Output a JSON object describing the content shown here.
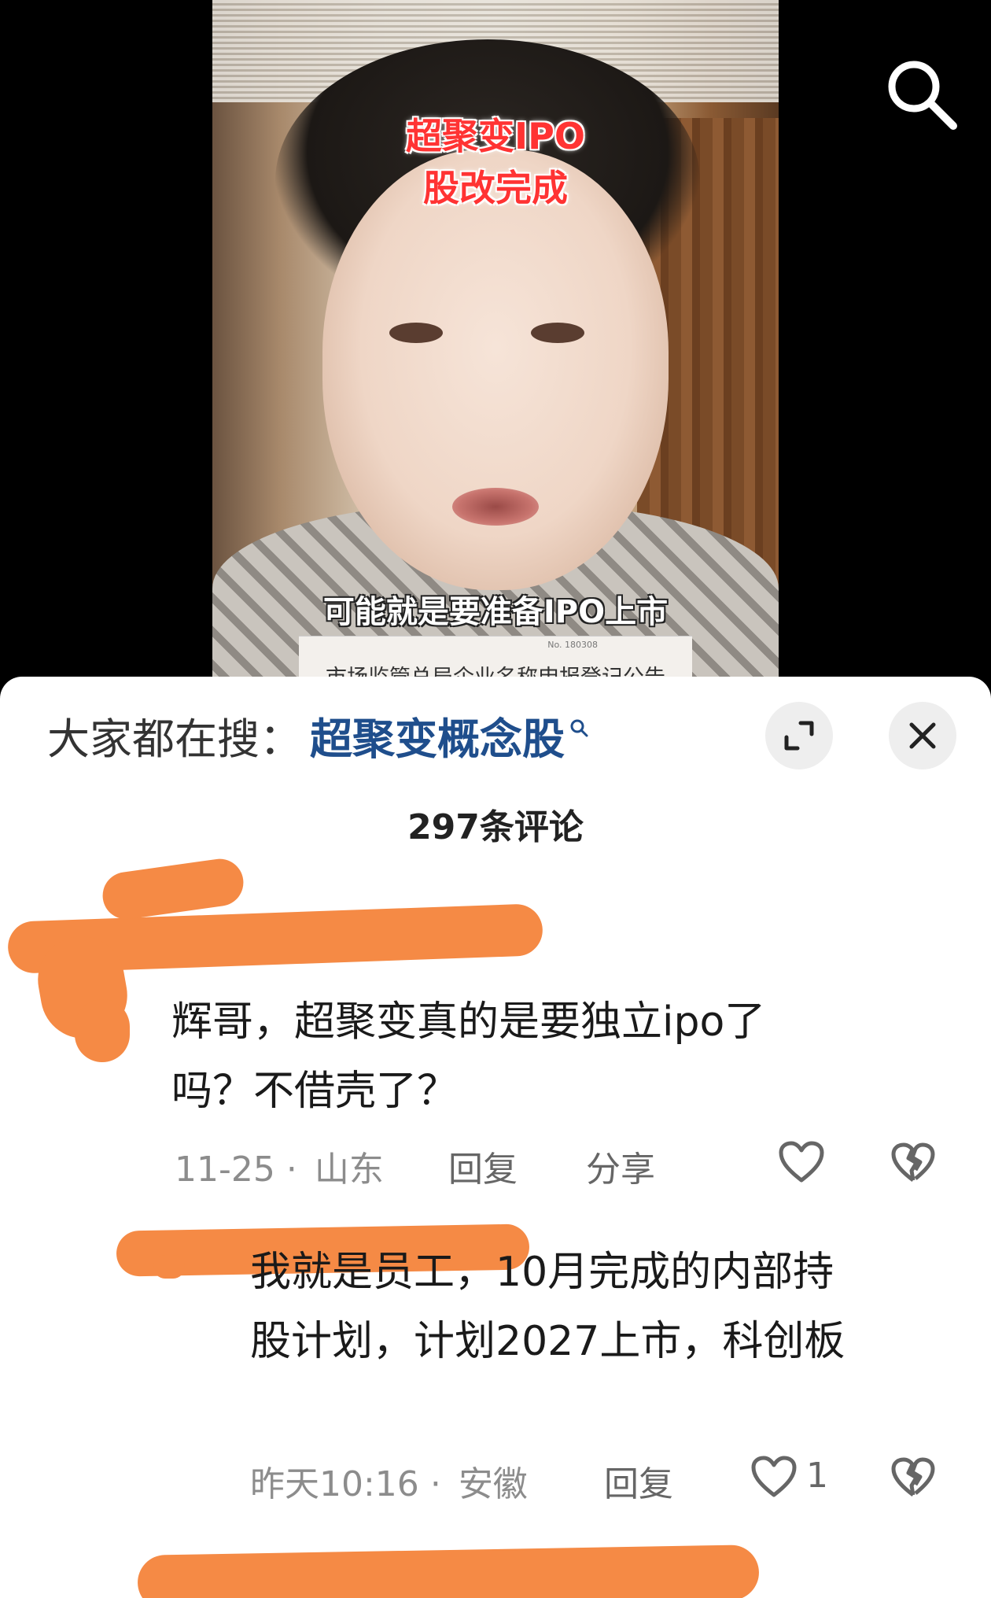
{
  "video": {
    "title_line1": "超聚变IPO",
    "title_line2": "股改完成",
    "subtitle": "可能就是要准备IPO上市",
    "doc_banner": "市场监管总局企业名称申报登记公告",
    "doc_number": "No. 180308"
  },
  "icons": {
    "search": "search-icon",
    "expand": "expand-icon",
    "close": "close-icon",
    "like": "heart-icon",
    "dislike": "broken-heart-icon"
  },
  "sheet": {
    "hot_search_label": "大家都在搜：",
    "hot_search_keyword": "超聚变概念股",
    "comment_count": "297条评论"
  },
  "comments": [
    {
      "line1": "辉哥，超聚变真的是要独立ipo了",
      "line2": "吗？不借壳了？",
      "date": "11-25",
      "separator": "·",
      "location": "山东",
      "reply": "回复",
      "share": "分享",
      "likes": ""
    },
    {
      "line1": "我就是员工，10月完成的内部持",
      "line2": "股计划，计划2027上市，科创板",
      "date": "昨天10:16",
      "separator": "·",
      "location": "安徽",
      "reply": "回复",
      "likes": "1"
    }
  ],
  "colors": {
    "accent_keyword": "#1f4e8c",
    "redaction": "#f58a45",
    "title_red": "#ff3333"
  }
}
